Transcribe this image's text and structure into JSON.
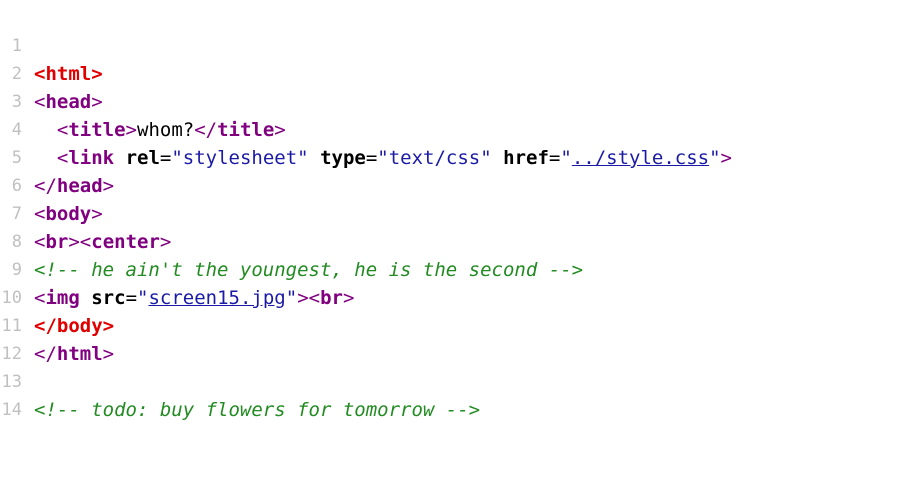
{
  "line_numbers": [
    "1",
    "2",
    "3",
    "4",
    "5",
    "6",
    "7",
    "8",
    "9",
    "10",
    "11",
    "12",
    "13",
    "14"
  ],
  "lines": {
    "l1": {
      "open": "<",
      "tag": "html",
      "close": ">"
    },
    "l2": {
      "open": "<",
      "tag": "head",
      "close": ">"
    },
    "l3": {
      "indent": "  ",
      "open": "<",
      "tag": "title",
      "close": ">",
      "text": "whom?",
      "end_open": "</",
      "end_tag": "title",
      "end_close": ">"
    },
    "l4": {
      "indent": "  ",
      "open": "<",
      "tag": "link",
      "a1": "rel",
      "eq1": "=",
      "v1": "\"stylesheet\"",
      "a2": "type",
      "eq2": "=",
      "v2": "\"text/css\"",
      "a3": "href",
      "eq3": "=",
      "q_open": "\"",
      "href": "../style.css",
      "q_close": "\"",
      "close": ">"
    },
    "l5": {
      "open": "</",
      "tag": "head",
      "close": ">"
    },
    "l6": {
      "open": "<",
      "tag": "body",
      "close": ">"
    },
    "l7": {
      "open": "<",
      "tag": "br",
      "close": ">",
      "open2": "<",
      "tag2": "center",
      "close2": ">"
    },
    "l8": {
      "comment": "<!-- he ain't the youngest, he is the second -->"
    },
    "l9": {
      "open": "<",
      "tag": "img",
      "a1": "src",
      "eq1": "=",
      "q_open": "\"",
      "src": "screen15.jpg",
      "q_close": "\"",
      "close": ">",
      "open2": "<",
      "tag2": "br",
      "close2": ">"
    },
    "l10": {
      "open": "</",
      "tag": "body",
      "close": ">"
    },
    "l11": {
      "open": "</",
      "tag": "html",
      "close": ">"
    },
    "l12": {},
    "l13": {
      "comment": "<!-- todo: buy flowers for tomorrow -->"
    },
    "l14": {}
  }
}
